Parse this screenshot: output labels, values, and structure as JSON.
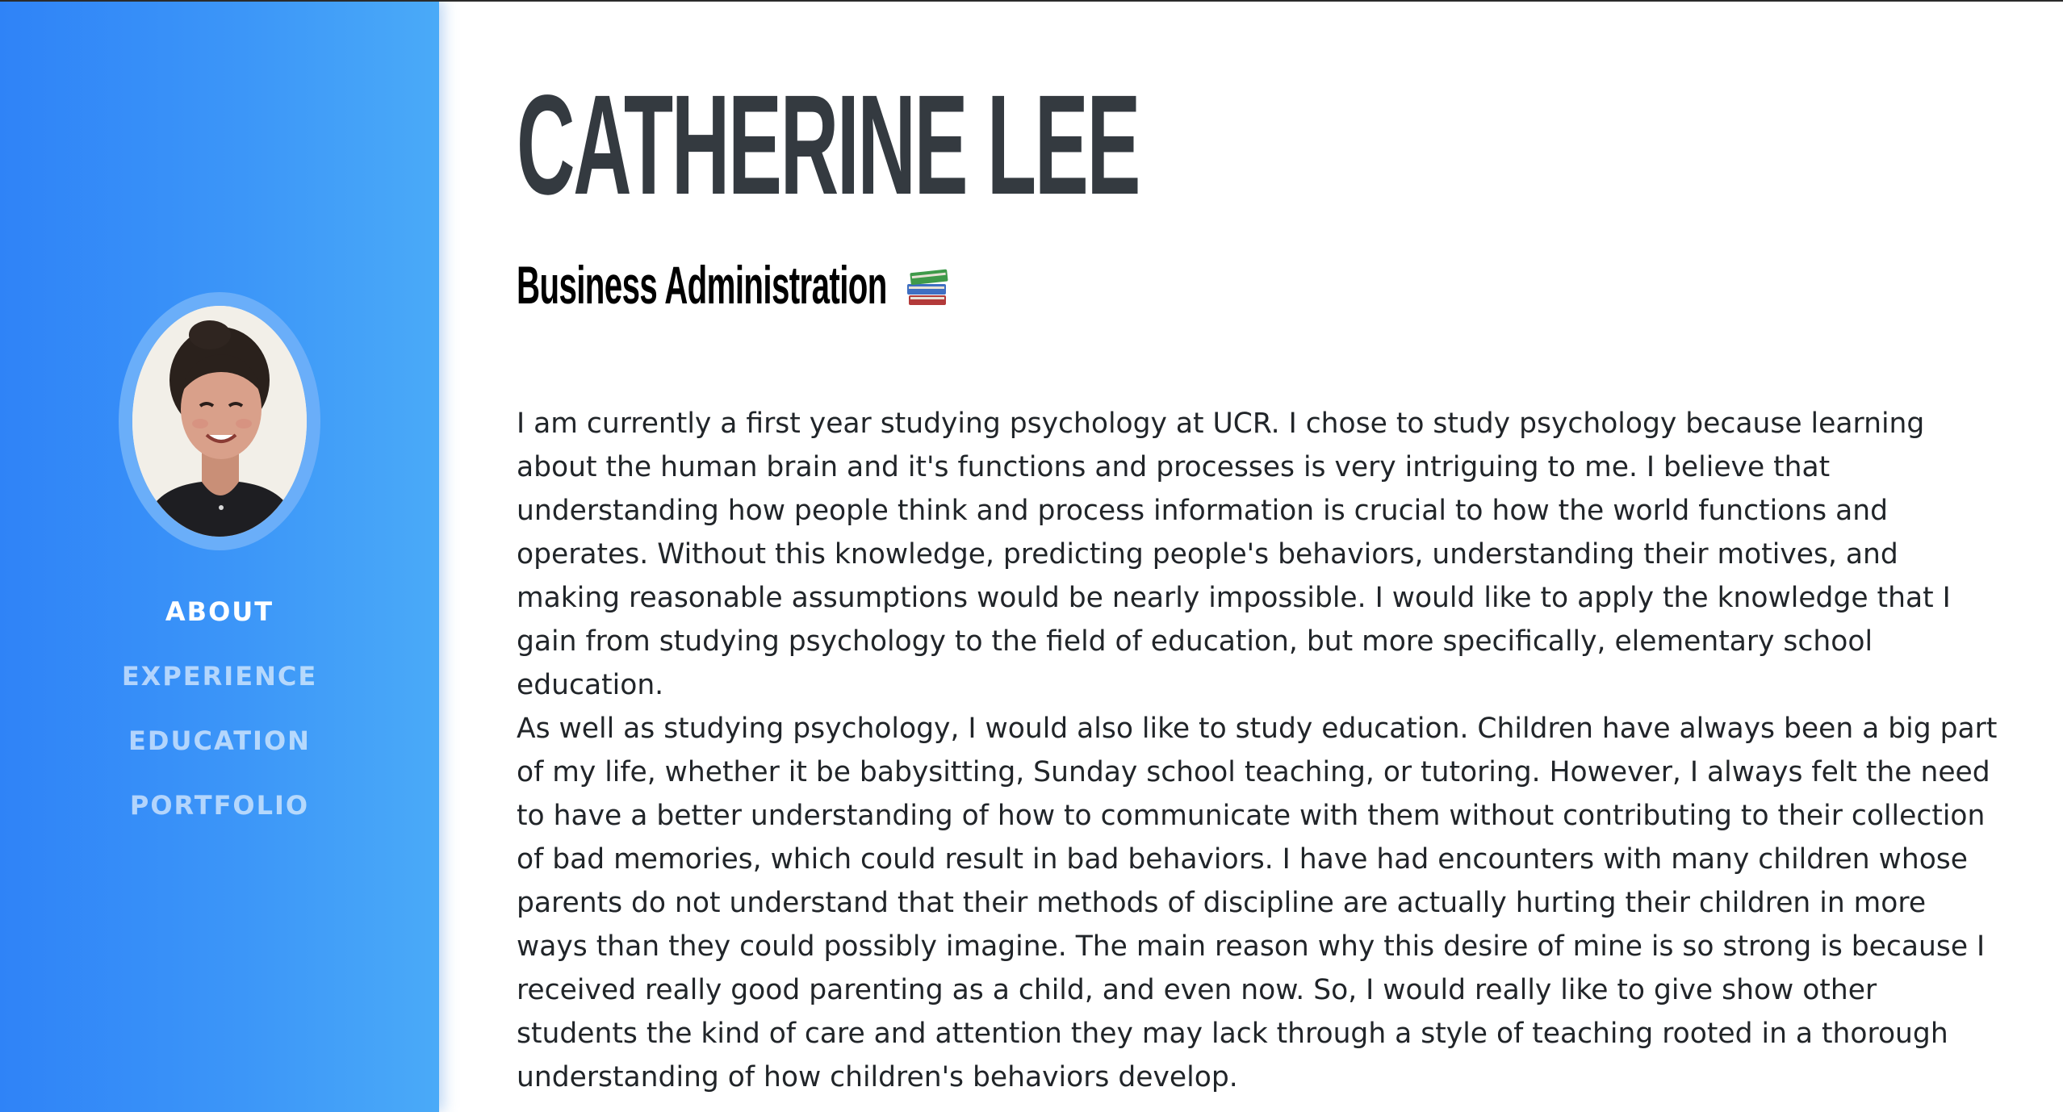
{
  "profile": {
    "name": "CATHERINE LEE",
    "subtitle": "Business Administration"
  },
  "icons": {
    "books": "books-emoji-icon"
  },
  "colors": {
    "sidebar": "#3a93f8",
    "heading": "#343a40",
    "body_text": "#212529",
    "nav_active": "#ffffff"
  },
  "nav": {
    "items": [
      {
        "label": "ABOUT",
        "active": true
      },
      {
        "label": "EXPERIENCE",
        "active": false
      },
      {
        "label": "EDUCATION",
        "active": false
      },
      {
        "label": "PORTFOLIO",
        "active": false
      }
    ]
  },
  "about": {
    "paragraphs": [
      "I am currently a first year studying psychology at UCR. I chose to study psychology because learning about the human brain and it's functions and processes is very intriguing to me. I believe that understanding how people think and process information is crucial to how the world functions and operates. Without this knowledge, predicting people's behaviors, understanding their motives, and making reasonable assumptions would be nearly impossible. I would like to apply the knowledge that I gain from studying psychology to the field of education, but more specifically, elementary school education.",
      "As well as studying psychology, I would also like to study education. Children have always been a big part of my life, whether it be babysitting, Sunday school teaching, or tutoring. However, I always felt the need to have a better understanding of how to communicate with them without contributing to their collection of bad memories, which could result in bad behaviors. I have had encounters with many children whose parents do not understand that their methods of discipline are actually hurting their children in more ways than they could possibly imagine. The main reason why this desire of mine is so strong is because I received really good parenting as a child, and even now. So, I would really like to give show other students the kind of care and attention they may lack through a style of teaching rooted in a thorough understanding of how children's behaviors develop."
    ]
  }
}
